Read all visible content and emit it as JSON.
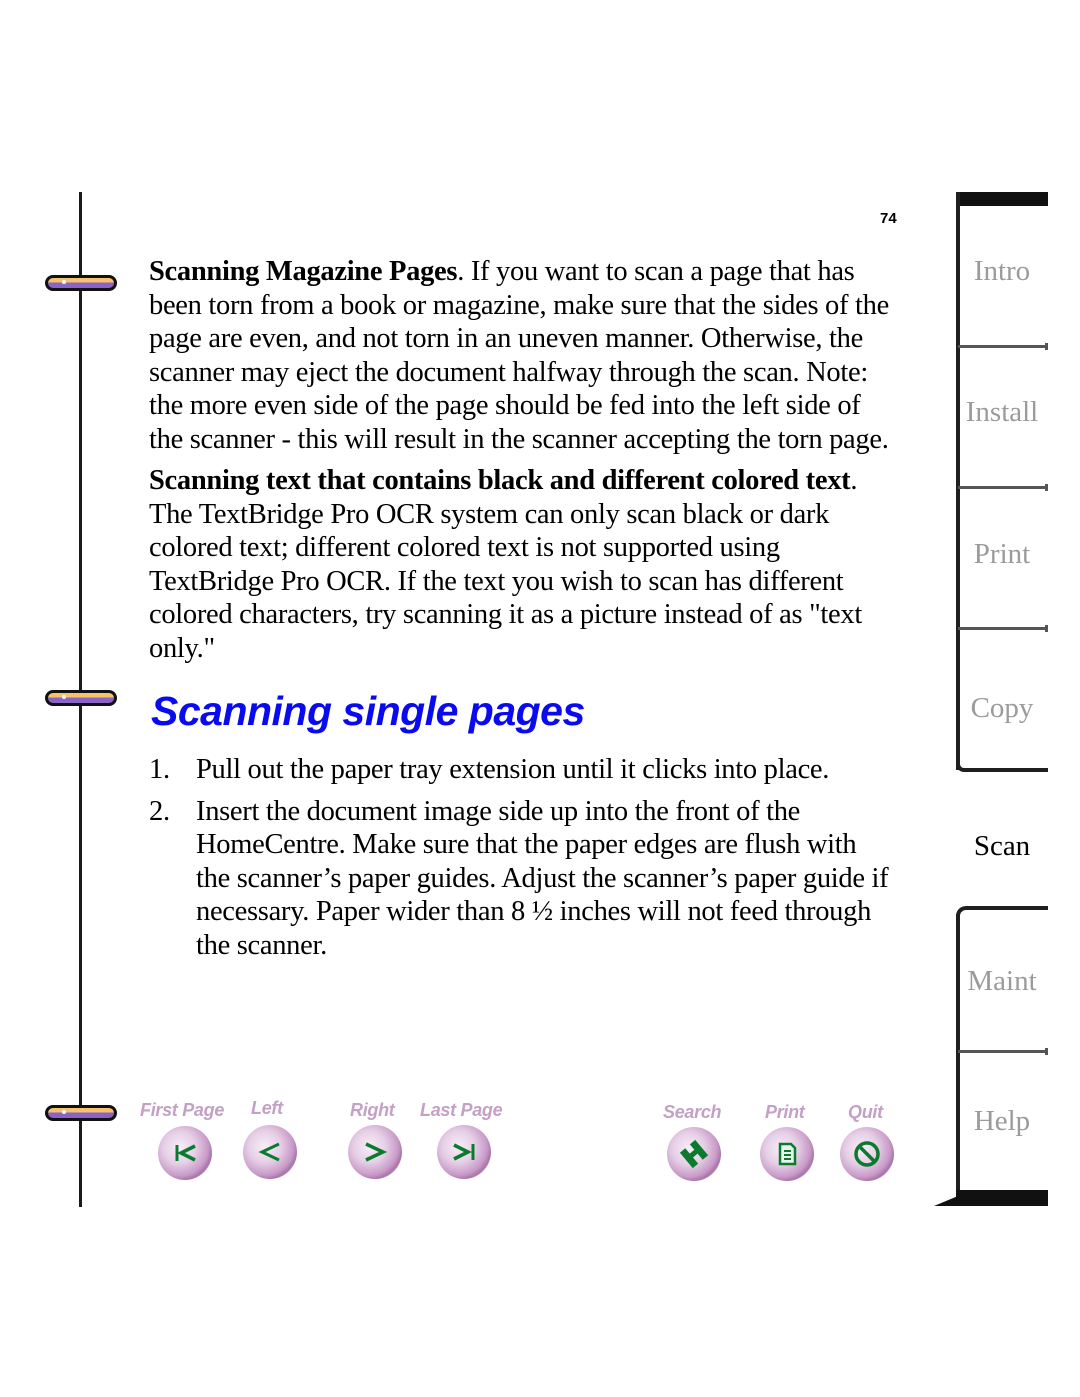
{
  "page": {
    "number": "74"
  },
  "content": {
    "para1": {
      "bold_lead": "Scanning Magazine Pages",
      "text": ". If you want to scan a page that has been torn from a book or magazine, make sure that the sides of the page are even, and not torn in an uneven manner. Otherwise, the scanner may eject the document halfway through the scan. Note: the more even side of the page should be fed into the left side of the scanner - this will result in the scanner accepting the torn page."
    },
    "para2": {
      "bold_lead": "Scanning text that contains black and different colored text",
      "text": ". The TextBridge Pro OCR system can only scan black or dark colored text; different colored text is not supported using TextBridge Pro OCR. If the text you wish to scan has different colored characters, try scanning it as a picture instead of as \"text only.\""
    },
    "section_heading": "Scanning single pages",
    "steps": [
      {
        "num": "1.",
        "text": "Pull out the paper tray extension until it clicks into place."
      },
      {
        "num": "2.",
        "text": "Insert the document image side up into the front of the HomeCentre. Make sure that the paper edges are flush with the scanner’s paper guides. Adjust the scanner’s paper guide if necessary. Paper wider than 8 ½ inches will not feed through the scanner."
      }
    ]
  },
  "nav_buttons": {
    "first_page": {
      "label": "First Page",
      "icon": "first-page-icon"
    },
    "left": {
      "label": "Left",
      "icon": "left-arrow-icon"
    },
    "right": {
      "label": "Right",
      "icon": "right-arrow-icon"
    },
    "last_page": {
      "label": "Last Page",
      "icon": "last-page-icon"
    },
    "search": {
      "label": "Search",
      "icon": "binoculars-icon"
    },
    "print": {
      "label": "Print",
      "icon": "document-icon"
    },
    "quit": {
      "label": "Quit",
      "icon": "no-entry-icon"
    }
  },
  "tabs": [
    {
      "label": "Intro",
      "active": false
    },
    {
      "label": "Install",
      "active": false
    },
    {
      "label": "Print",
      "active": false
    },
    {
      "label": "Copy",
      "active": false
    },
    {
      "label": "Scan",
      "active": true
    },
    {
      "label": "Maint",
      "active": false
    },
    {
      "label": "Help",
      "active": false
    }
  ],
  "colors": {
    "heading": "#0a0af0",
    "nav_label": "#c5a0c5",
    "nav_icon": "#0b7a2e",
    "tab_inactive": "#9b9b9b",
    "tab_active": "#000000"
  }
}
